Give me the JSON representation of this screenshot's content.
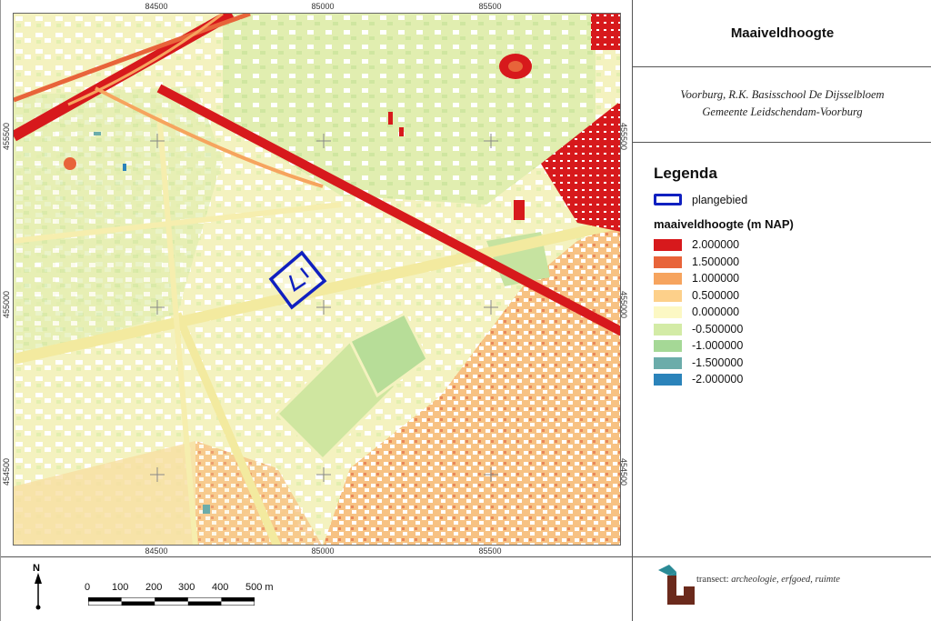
{
  "map": {
    "x_ticks_top": [
      "84500",
      "85000",
      "85500"
    ],
    "x_ticks_bottom": [
      "84500",
      "85000",
      "85500"
    ],
    "y_ticks_left": [
      "455500",
      "455000",
      "454500"
    ],
    "y_ticks_right": [
      "455500",
      "455000",
      "454500"
    ]
  },
  "title": "Maaiveldhoogte",
  "subtitle_line1": "Voorburg, R.K. Basisschool De Dijsselbloem",
  "subtitle_line2": "Gemeente Leidschendam-Voorburg",
  "legend": {
    "title": "Legenda",
    "plan_label": "plangebied",
    "plan_color": "#1020c0",
    "height_title": "maaiveldhoogte (m NAP)",
    "classes": [
      {
        "label": "2.000000",
        "color": "#d7191c"
      },
      {
        "label": "1.500000",
        "color": "#e8643a"
      },
      {
        "label": "1.000000",
        "color": "#f6a45e"
      },
      {
        "label": "0.500000",
        "color": "#fdd08a"
      },
      {
        "label": "0.000000",
        "color": "#fcf8c4"
      },
      {
        "label": "-0.500000",
        "color": "#d3eba6"
      },
      {
        "label": "-1.000000",
        "color": "#a5d896"
      },
      {
        "label": "-1.500000",
        "color": "#6bacaa"
      },
      {
        "label": "-2.000000",
        "color": "#2b83ba"
      }
    ]
  },
  "north_label": "N",
  "scale": {
    "labels": [
      "0",
      "100",
      "200",
      "300",
      "400",
      "500 m"
    ]
  },
  "logo": {
    "brand": "transect:",
    "tagline": "archeologie, erfgoed, ruimte",
    "colors": {
      "teal": "#2a8a96",
      "brown": "#6b2a1c"
    }
  }
}
